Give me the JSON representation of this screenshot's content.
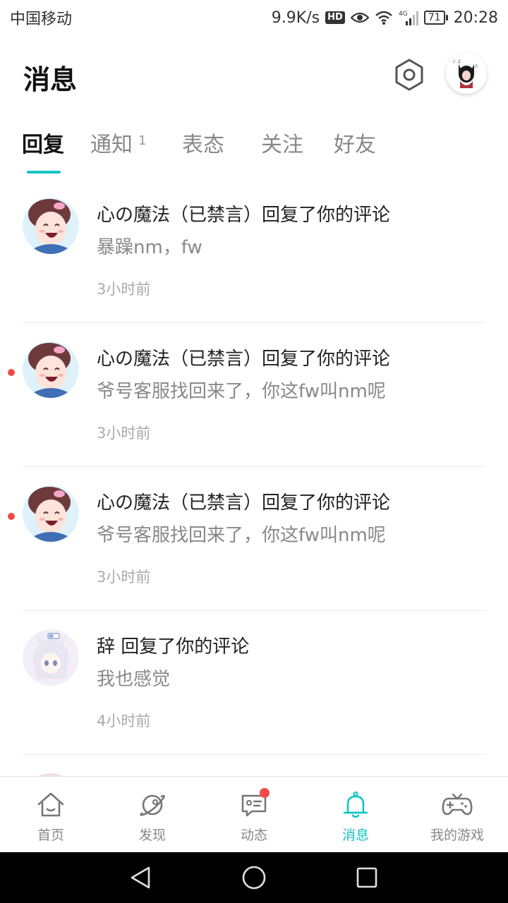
{
  "status_bar": {
    "carrier": "中国移动",
    "speed": "9.9K/s",
    "hd": "HD",
    "network": "4G",
    "battery": "71",
    "time": "20:28"
  },
  "header": {
    "title": "消息",
    "settings_icon": "settings-hexagon-icon",
    "avatar": "user-avatar"
  },
  "tabs": [
    {
      "label": "回复",
      "active": true,
      "badge": ""
    },
    {
      "label": "通知",
      "active": false,
      "badge": "1"
    },
    {
      "label": "表态",
      "active": false,
      "badge": ""
    },
    {
      "label": "关注",
      "active": false,
      "badge": ""
    },
    {
      "label": "好友",
      "active": false,
      "badge": ""
    }
  ],
  "messages": [
    {
      "title": "心の魔法（已禁言）回复了你的评论",
      "body": "暴躁nm，fw",
      "time": "3小时前",
      "unread": false
    },
    {
      "title": "心の魔法（已禁言）回复了你的评论",
      "body": "爷号客服找回来了，你这fw叫nm呢",
      "time": "3小时前",
      "unread": true
    },
    {
      "title": "心の魔法（已禁言）回复了你的评论",
      "body": "爷号客服找回来了，你这fw叫nm呢",
      "time": "3小时前",
      "unread": true
    },
    {
      "title": "辞 回复了你的评论",
      "body": "我也感觉",
      "time": "4小时前",
      "unread": false
    }
  ],
  "bottom_nav": [
    {
      "label": "首页",
      "icon": "home-icon",
      "active": false
    },
    {
      "label": "发现",
      "icon": "planet-icon",
      "active": false
    },
    {
      "label": "动态",
      "icon": "feed-icon",
      "active": false,
      "dot": true
    },
    {
      "label": "消息",
      "icon": "bell-icon",
      "active": true
    },
    {
      "label": "我的游戏",
      "icon": "gamepad-icon",
      "active": false
    }
  ],
  "colors": {
    "accent": "#14c3c3",
    "unread": "#f04a4a",
    "muted": "#888888"
  }
}
